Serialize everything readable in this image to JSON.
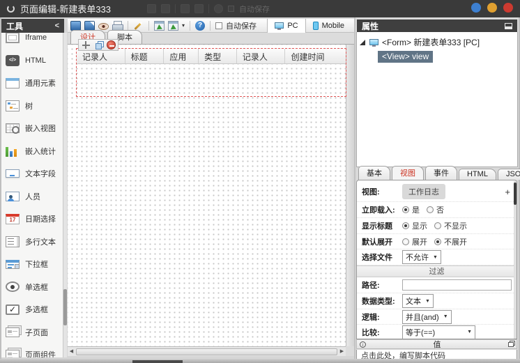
{
  "titlebar": {
    "title": "页面编辑-新建表单333",
    "ghost_autosave_label": "自动保存"
  },
  "sidebar": {
    "header": "工具",
    "collapse_glyph": "<",
    "items": [
      {
        "label": "Iframe",
        "icon": "iframe"
      },
      {
        "label": "HTML",
        "icon": "html",
        "glyph": "</>"
      },
      {
        "label": "通用元素",
        "icon": "generic-element"
      },
      {
        "label": "树",
        "icon": "tree"
      },
      {
        "label": "嵌入视图",
        "icon": "embed-view"
      },
      {
        "label": "嵌入统计",
        "icon": "embed-stats"
      },
      {
        "label": "文本字段",
        "icon": "text-field"
      },
      {
        "label": "人员",
        "icon": "person"
      },
      {
        "label": "日期选择",
        "icon": "date-picker",
        "glyph": "17"
      },
      {
        "label": "多行文本",
        "icon": "multiline-text"
      },
      {
        "label": "下拉框",
        "icon": "dropdown"
      },
      {
        "label": "单选框",
        "icon": "radio"
      },
      {
        "label": "多选框",
        "icon": "checkbox",
        "glyph": "✓"
      },
      {
        "label": "子页面",
        "icon": "subpage"
      },
      {
        "label": "页面组件",
        "icon": "page-component"
      }
    ]
  },
  "toolbar": {
    "autosave_label": "自动保存",
    "pc_label": "PC",
    "mobile_label": "Mobile"
  },
  "canvas": {
    "tabs": [
      {
        "label": "设计",
        "active": true
      },
      {
        "label": "脚本",
        "active": false
      }
    ],
    "table_columns": [
      "记录人",
      "标题",
      "应用",
      "类型",
      "记录人",
      "创建时间"
    ]
  },
  "properties": {
    "header": "属性",
    "tree": {
      "form_node": "<Form> 新建表单333 [PC]",
      "view_node": "<View> view"
    },
    "tabs": [
      "基本",
      "视图",
      "事件",
      "HTML",
      "JSON"
    ],
    "active_tab": "视图",
    "fields": {
      "view": {
        "label": "视图:",
        "value": "工作日志",
        "add_glyph": "+"
      },
      "load": {
        "label": "立即载入:",
        "options": [
          "是",
          "否"
        ],
        "selected": "是"
      },
      "show_title": {
        "label": "显示标题",
        "options": [
          "显示",
          "不显示"
        ],
        "selected": "显示"
      },
      "expand": {
        "label": "默认展开",
        "options": [
          "展开",
          "不展开"
        ],
        "selected": "不展开"
      },
      "file": {
        "label": "选择文件",
        "value": "不允许"
      },
      "filter_section": "过滤",
      "path": {
        "label": "路径:",
        "value": ""
      },
      "data_type": {
        "label": "数据类型:",
        "value": "文本"
      },
      "logic": {
        "label": "逻辑:",
        "value": "并且(and)"
      },
      "compare": {
        "label": "比较:",
        "value": "等于(==)"
      },
      "value_header": "值",
      "script_hint": "点击此处，编写脚本代码"
    }
  },
  "colors": {
    "accent_red": "#cc3322",
    "selection_blue_gray": "#607486",
    "dashed_selection": "#e05555",
    "dark_header": "#3f3f3f"
  }
}
